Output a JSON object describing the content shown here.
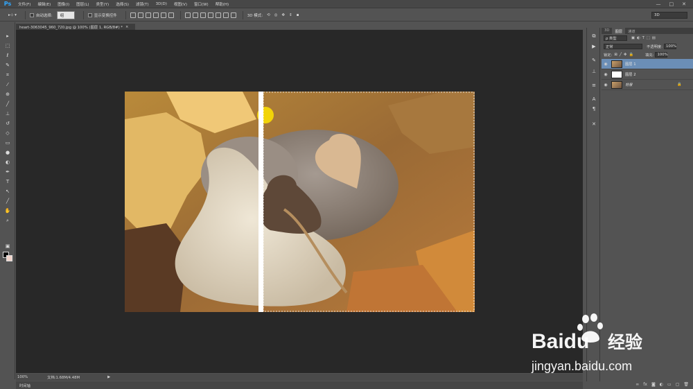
{
  "app": {
    "logo": "Ps"
  },
  "menu": [
    "文件(F)",
    "编辑(E)",
    "图像(I)",
    "图层(L)",
    "类型(Y)",
    "选择(S)",
    "滤镜(T)",
    "3D(D)",
    "视图(V)",
    "窗口(W)",
    "帮助(H)"
  ],
  "window_controls": [
    "—",
    "□",
    "✕"
  ],
  "options_bar": {
    "auto_select_label": "自动选择:",
    "auto_select_value": "组",
    "show_transform_label": "显示变换控件",
    "mode_3d_label": "3D 模式:",
    "workspace": "3D"
  },
  "document": {
    "tab_title": "heart-3063045_960_720.jpg @ 100% (图层 1, RGB/8#) *",
    "close": "×",
    "zoom": "100%",
    "doc_size": "文档:1.68M/4.48M"
  },
  "timeline_label": "时间轴",
  "panel": {
    "tabs": [
      "3D",
      "图层",
      "通道"
    ],
    "active_tab": "图层",
    "kind_filter": "ρ 类型",
    "blend_mode": "正常",
    "opacity_label": "不透明度:",
    "opacity_value": "100%",
    "lock_label": "锁定:",
    "fill_label": "填充:",
    "fill_value": "100%",
    "layers": [
      {
        "name": "图层 1",
        "active": true,
        "thumb": "photo",
        "locked": false
      },
      {
        "name": "图层 2",
        "active": false,
        "thumb": "white",
        "locked": false
      },
      {
        "name": "背景",
        "active": false,
        "thumb": "photo",
        "locked": true
      }
    ],
    "footer_icons": [
      "link-icon",
      "fx-icon",
      "mask-icon",
      "adjustment-icon",
      "folder-icon",
      "new-layer-icon",
      "trash-icon"
    ]
  },
  "watermark": {
    "brand": "Baidu",
    "brand_cn": "经验",
    "url": "jingyan.baidu.com"
  },
  "colors": {
    "accent": "#31a8ff",
    "active_layer": "#6b8eb6",
    "canvas_bg": "#282828",
    "fg_color": "#000000",
    "bg_color": "#f1d4cb"
  }
}
